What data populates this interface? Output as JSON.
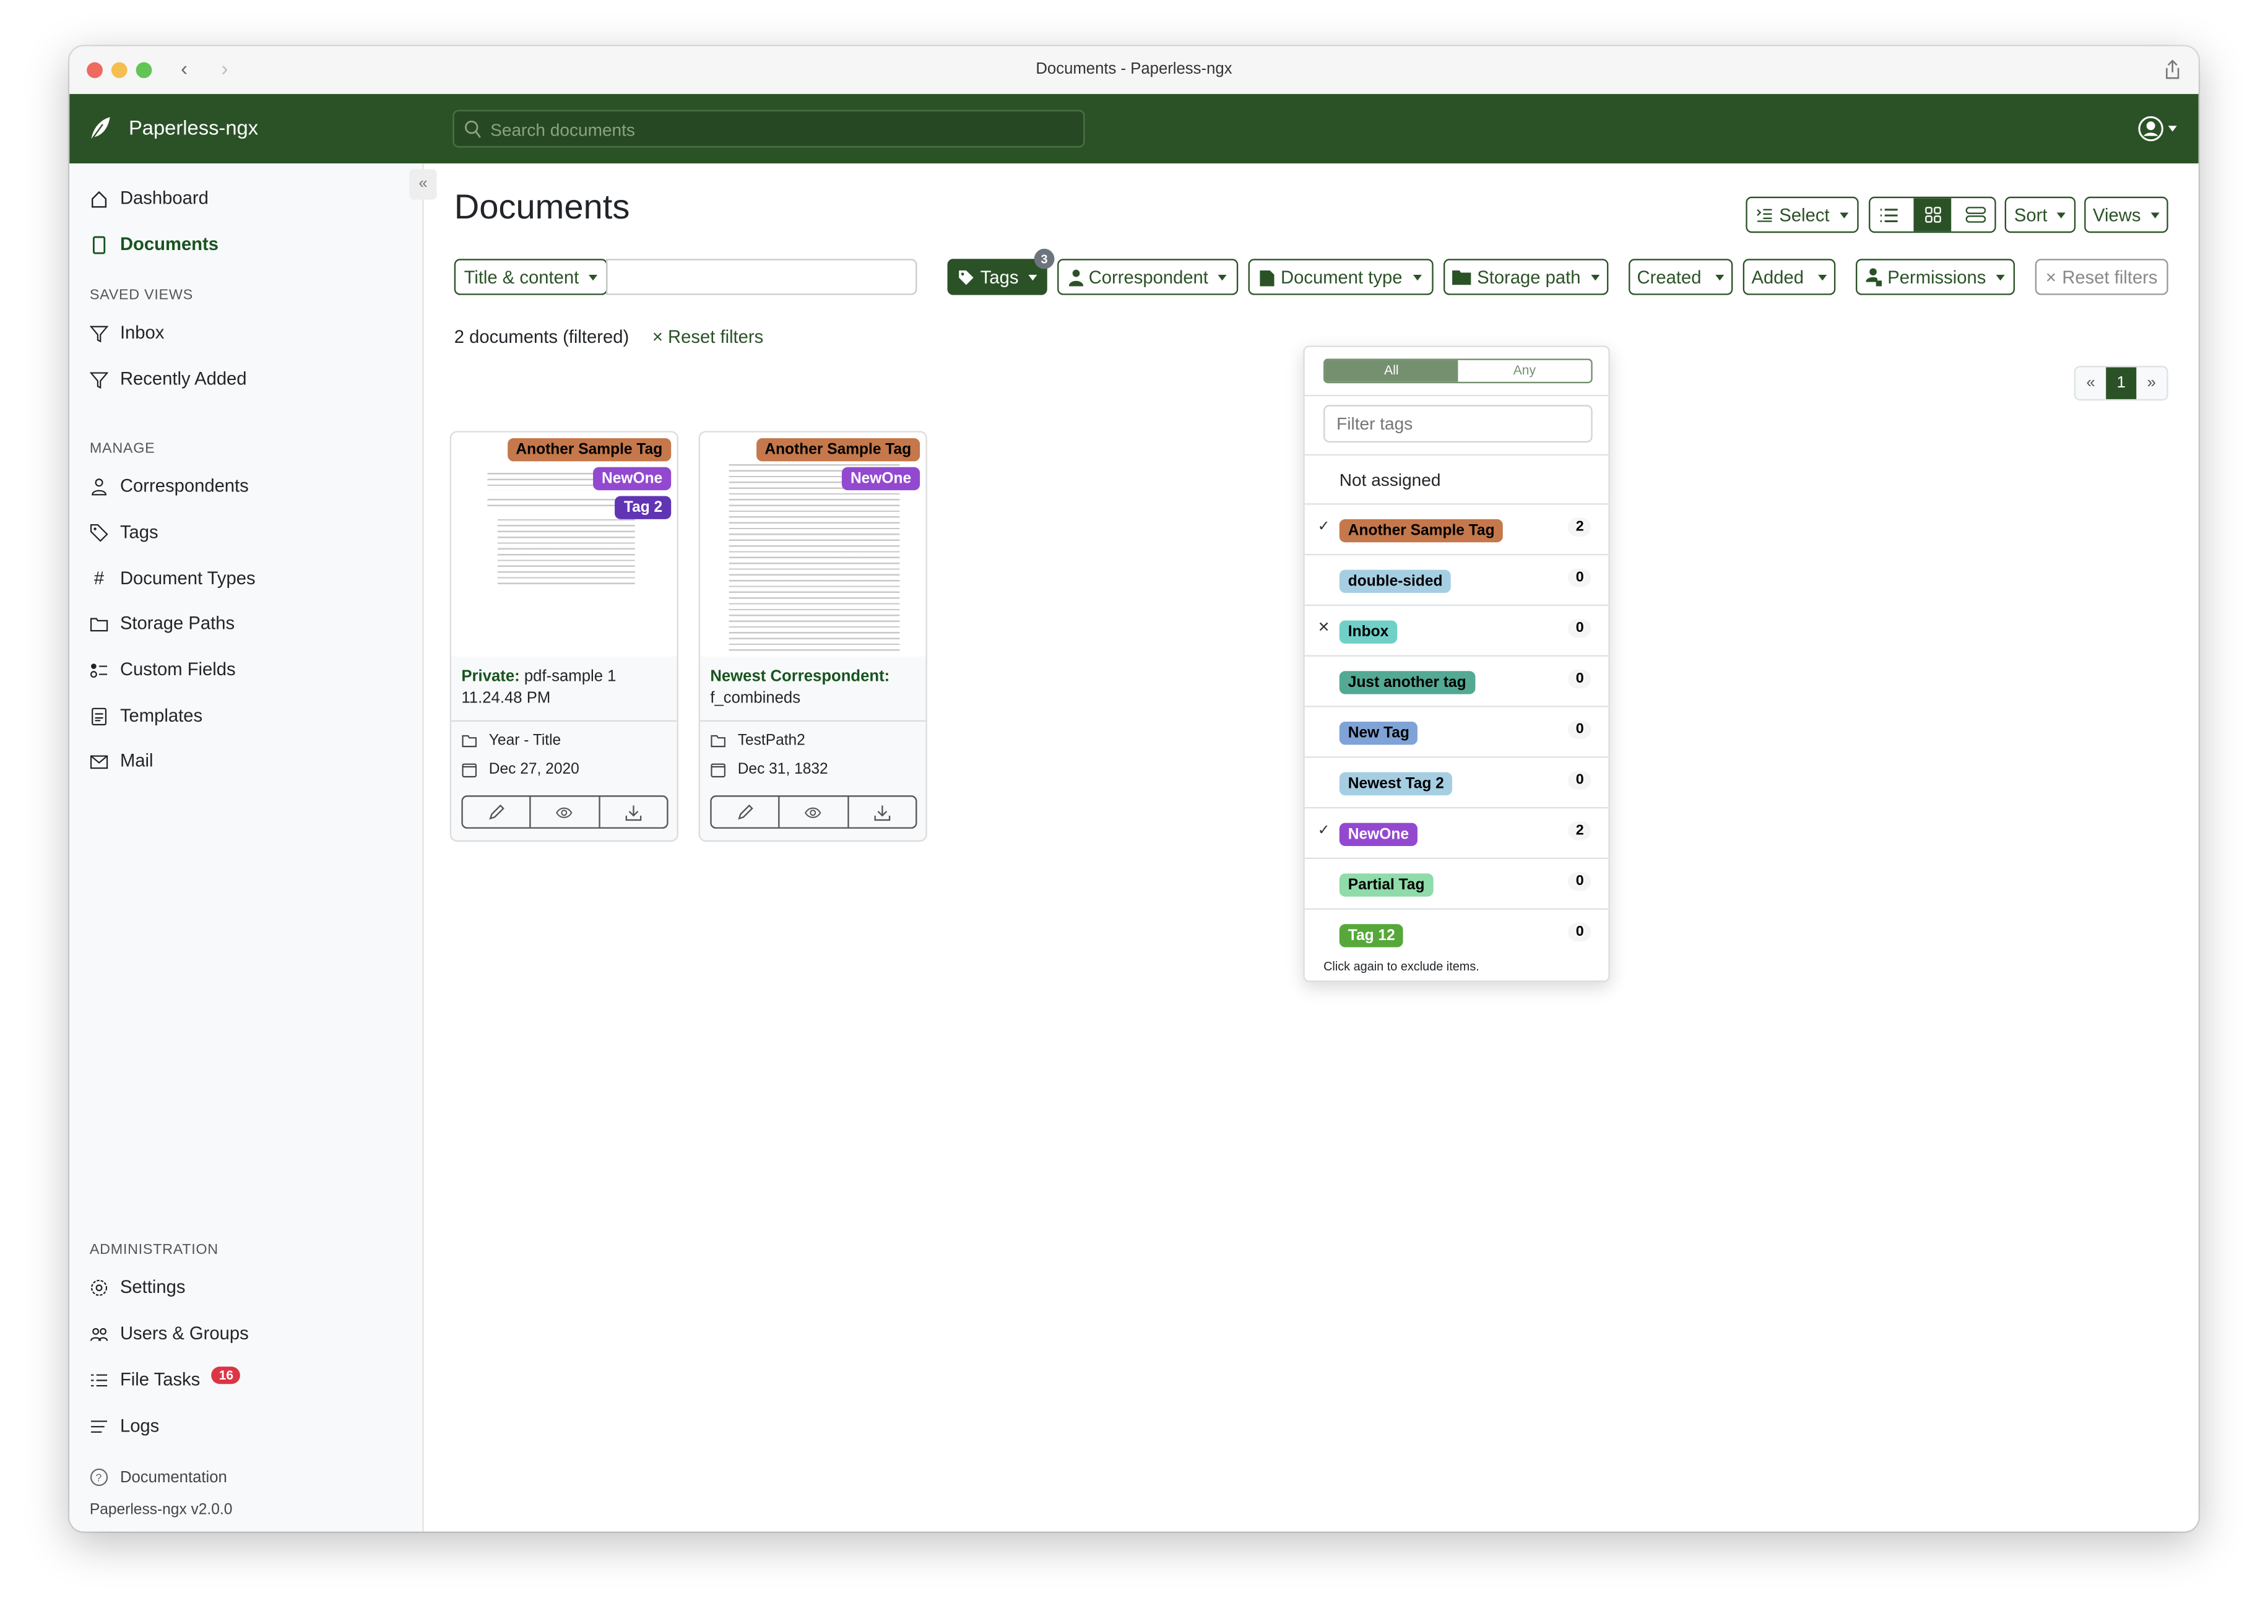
{
  "window": {
    "title": "Documents - Paperless-ngx"
  },
  "header": {
    "brand": "Paperless-ngx",
    "search_placeholder": "Search documents",
    "icons": [
      "leaf-icon",
      "search-icon",
      "user-circle-icon"
    ]
  },
  "sidebar": {
    "items": [
      {
        "label": "Dashboard",
        "icon": "house-icon"
      },
      {
        "label": "Documents",
        "icon": "file-icon",
        "active": true
      }
    ],
    "saved_views_heading": "SAVED VIEWS",
    "saved_views": [
      {
        "label": "Inbox"
      },
      {
        "label": "Recently Added"
      }
    ],
    "manage_heading": "MANAGE",
    "manage": [
      {
        "label": "Correspondents"
      },
      {
        "label": "Tags"
      },
      {
        "label": "Document Types"
      },
      {
        "label": "Storage Paths"
      },
      {
        "label": "Custom Fields"
      },
      {
        "label": "Templates"
      },
      {
        "label": "Mail"
      }
    ],
    "admin_heading": "ADMINISTRATION",
    "admin": [
      {
        "label": "Settings"
      },
      {
        "label": "Users & Groups"
      },
      {
        "label": "File Tasks",
        "badge": "16"
      },
      {
        "label": "Logs"
      }
    ],
    "documentation": "Documentation",
    "version": "Paperless-ngx v2.0.0"
  },
  "main": {
    "title": "Documents",
    "toolbar": {
      "select": "Select",
      "sort": "Sort",
      "views": "Views",
      "view_mode": "small-cards"
    },
    "filters": {
      "text_mode": "Title & content",
      "text_value": "",
      "tags": "Tags",
      "tags_count": "3",
      "correspondent": "Correspondent",
      "document_type": "Document type",
      "storage_path": "Storage path",
      "created": "Created",
      "added": "Added",
      "permissions": "Permissions",
      "reset": "Reset filters"
    },
    "status": {
      "count": "2 documents (filtered)",
      "reset": "Reset filters"
    },
    "pagination": {
      "prev": "«",
      "page": "1",
      "next": "»"
    },
    "documents": [
      {
        "tags": [
          {
            "name": "Another Sample Tag",
            "color": "#c5784b",
            "text": "#000"
          },
          {
            "name": "NewOne",
            "color": "#9249d0",
            "text": "#fff"
          },
          {
            "name": "Tag 2",
            "color": "#6034b3",
            "text": "#fff"
          }
        ],
        "correspondent": "Private:",
        "title": "pdf-sample 1 11.24.48 PM",
        "storage_path": "Year - Title",
        "date": "Dec 27, 2020"
      },
      {
        "tags": [
          {
            "name": "Another Sample Tag",
            "color": "#c5784b",
            "text": "#000"
          },
          {
            "name": "NewOne",
            "color": "#9249d0",
            "text": "#fff"
          }
        ],
        "correspondent": "Newest Correspondent:",
        "title": "f_combineds",
        "storage_path": "TestPath2",
        "date": "Dec 31, 1832"
      }
    ]
  },
  "tags_dropdown": {
    "logic": {
      "all": "All",
      "any": "Any",
      "selected": "All"
    },
    "filter_placeholder": "Filter tags",
    "not_assigned": "Not assigned",
    "items": [
      {
        "name": "Another Sample Tag",
        "color": "#c5784b",
        "text": "#000",
        "state": "included",
        "count": "2"
      },
      {
        "name": "double-sided",
        "color": "#a6cee3",
        "text": "#000",
        "state": "",
        "count": "0"
      },
      {
        "name": "Inbox",
        "color": "#70d0c8",
        "text": "#000",
        "state": "excluded",
        "count": "0"
      },
      {
        "name": "Just another tag",
        "color": "#53a993",
        "text": "#000",
        "state": "",
        "count": "0"
      },
      {
        "name": "New Tag",
        "color": "#7fa3d6",
        "text": "#000",
        "state": "",
        "count": "0"
      },
      {
        "name": "Newest Tag 2",
        "color": "#a6cee3",
        "text": "#000",
        "state": "",
        "count": "0"
      },
      {
        "name": "NewOne",
        "color": "#9249d0",
        "text": "#fff",
        "state": "included",
        "count": "2"
      },
      {
        "name": "Partial Tag",
        "color": "#8fdba9",
        "text": "#000",
        "state": "",
        "count": "0"
      },
      {
        "name": "Tag 12",
        "color": "#56a83a",
        "text": "#fff",
        "state": "",
        "count": "0"
      }
    ],
    "marks": {
      "included": "✓",
      "excluded": "✕"
    },
    "hint": "Click again to exclude items."
  },
  "colors": {
    "primary": "#2b5227",
    "danger": "#dc3545"
  }
}
